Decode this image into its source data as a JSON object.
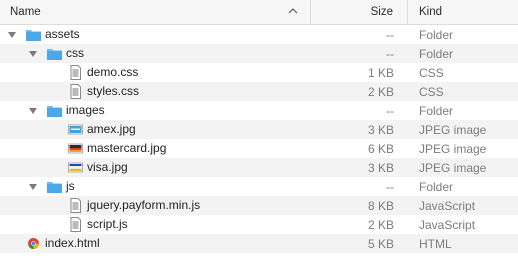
{
  "columns": {
    "name": "Name",
    "size": "Size",
    "kind": "Kind"
  },
  "colors": {
    "folder": "#5fb4ef",
    "selection_none": "#ffffff",
    "alt_row": "#f3f3f4",
    "secondary_text": "#7c7c7c"
  },
  "rows": [
    {
      "name": "assets",
      "size": "--",
      "kind": "Folder",
      "type": "folder",
      "expanded": true
    },
    {
      "name": "css",
      "size": "--",
      "kind": "Folder",
      "type": "folder",
      "expanded": true
    },
    {
      "name": "demo.css",
      "size": "1 KB",
      "kind": "CSS",
      "type": "text-file"
    },
    {
      "name": "styles.css",
      "size": "2 KB",
      "kind": "CSS",
      "type": "text-file"
    },
    {
      "name": "images",
      "size": "--",
      "kind": "Folder",
      "type": "folder",
      "expanded": true
    },
    {
      "name": "amex.jpg",
      "size": "3 KB",
      "kind": "JPEG image",
      "type": "image-amex"
    },
    {
      "name": "mastercard.jpg",
      "size": "6 KB",
      "kind": "JPEG image",
      "type": "image-mastercard"
    },
    {
      "name": "visa.jpg",
      "size": "3 KB",
      "kind": "JPEG image",
      "type": "image-visa"
    },
    {
      "name": "js",
      "size": "--",
      "kind": "Folder",
      "type": "folder",
      "expanded": true
    },
    {
      "name": "jquery.payform.min.js",
      "size": "8 KB",
      "kind": "JavaScript",
      "type": "text-file"
    },
    {
      "name": "script.js",
      "size": "2 KB",
      "kind": "JavaScript",
      "type": "text-file"
    },
    {
      "name": "index.html",
      "size": "5 KB",
      "kind": "HTML",
      "type": "html-file"
    }
  ]
}
